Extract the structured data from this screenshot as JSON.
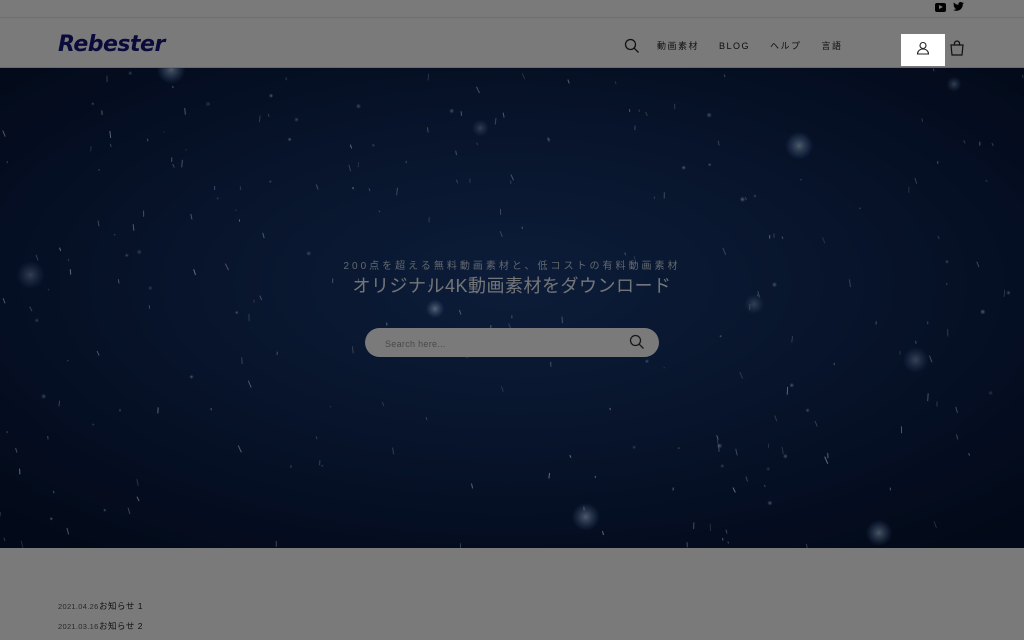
{
  "brand": {
    "logo_text": "Rebester",
    "logo_color": "#15157c"
  },
  "social": {
    "youtube_icon": "youtube-icon",
    "twitter_icon": "twitter-icon"
  },
  "nav": {
    "search_icon": "search-icon",
    "items": [
      {
        "label": "動画素材"
      },
      {
        "label": "BLOG"
      },
      {
        "label": "ヘルプ"
      },
      {
        "label": "言語"
      }
    ],
    "account_icon": "user-icon",
    "cart_icon": "cart-icon"
  },
  "hero": {
    "subtitle": "200点を超える無料動画素材と、低コストの有料動画素材",
    "title": "オリジナル4K動画素材をダウンロード",
    "search_placeholder": "Search here...",
    "background_color": "#0f2750"
  },
  "news": [
    {
      "date": "2021.04.26",
      "title": "お知らせ 1"
    },
    {
      "date": "2021.03.16",
      "title": "お知らせ 2"
    }
  ],
  "overlay": {
    "dim_color": "rgba(0,0,0,0.52)"
  }
}
